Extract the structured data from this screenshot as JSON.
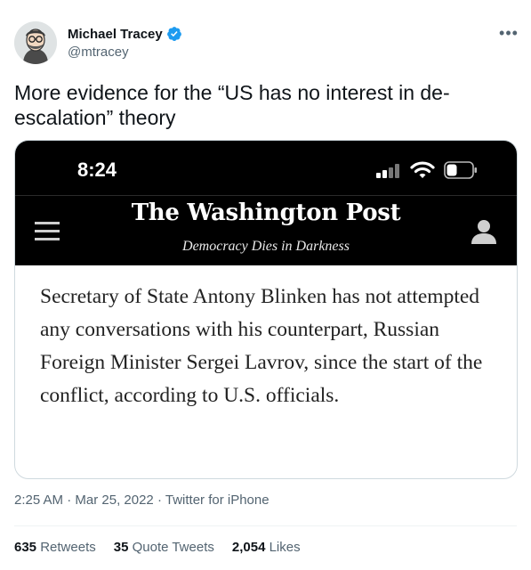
{
  "author": {
    "name": "Michael Tracey",
    "handle": "@mtracey",
    "verified_icon": "verified-badge-icon",
    "avatar_icon": "avatar-illustration"
  },
  "more_menu": {
    "label": "•••"
  },
  "tweet": {
    "text": "More evidence for the “US has no interest in de-escalation” theory"
  },
  "screenshot": {
    "clock": "8:24",
    "masthead": "The Washington Post",
    "motto": "Democracy Dies in Darkness",
    "article_text": "Secretary of State Antony Blinken has not attempted any conversations with his counterpart, Russian Foreign Minister Sergei Lavrov, since the start of the conflict, according to U.S. officials.",
    "icons": [
      "signal-icon",
      "wifi-icon",
      "battery-icon",
      "menu-icon",
      "profile-icon"
    ]
  },
  "meta": {
    "time": "2:25 AM",
    "date": "Mar 25, 2022",
    "source": "Twitter for iPhone",
    "separator": "·"
  },
  "stats": {
    "retweets_count": "635",
    "retweets_label": "Retweets",
    "quotes_count": "35",
    "quotes_label": "Quote Tweets",
    "likes_count": "2,054",
    "likes_label": "Likes"
  },
  "colors": {
    "verified_blue": "#1d9bf0",
    "text_primary": "#0f1419",
    "text_secondary": "#536471",
    "border": "#cfd9de"
  }
}
